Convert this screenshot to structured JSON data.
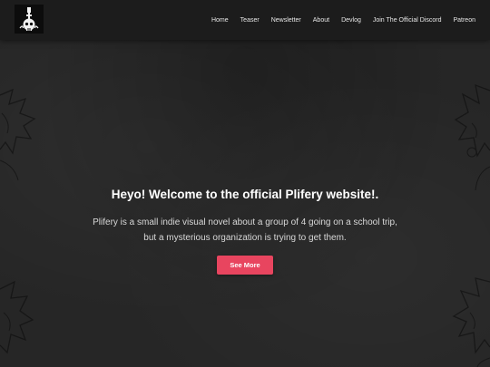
{
  "brand": {
    "logo_icon": "candle-skull-logo-icon"
  },
  "nav": {
    "items": [
      {
        "label": "Home"
      },
      {
        "label": "Teaser"
      },
      {
        "label": "Newsletter"
      },
      {
        "label": "About"
      },
      {
        "label": "Devlog"
      },
      {
        "label": "Join The Official Discord"
      },
      {
        "label": "Patreon"
      }
    ]
  },
  "hero": {
    "title": "Heyo! Welcome to the official Plifery website!.",
    "description": "Plifery is a small indie visual novel about a group of 4 going on a school trip, but a mysterious organization is trying to get them.",
    "cta_label": "See More"
  },
  "colors": {
    "header_bg": "#1c1c1c",
    "page_bg": "#262626",
    "accent": "#e8455f",
    "text": "#ffffff"
  }
}
